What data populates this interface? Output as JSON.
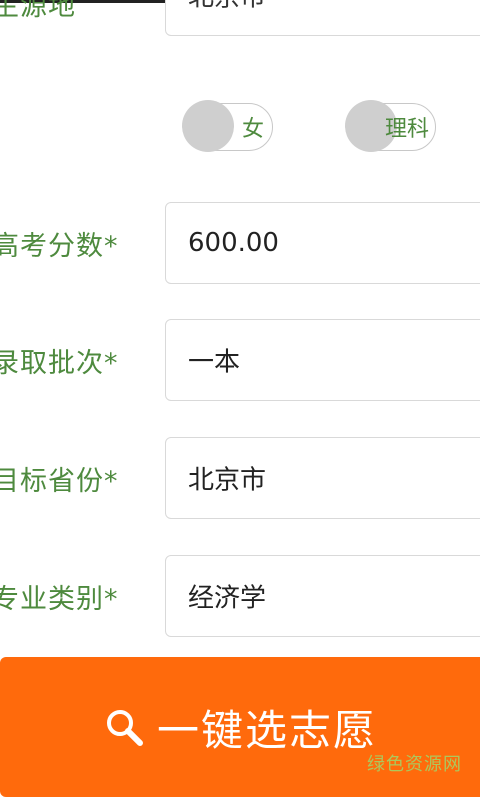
{
  "form": {
    "partial_row": {
      "label": "生源地",
      "value": "北京市"
    },
    "gender_toggle": {
      "label": "女"
    },
    "subject_toggle": {
      "label": "理科"
    },
    "score": {
      "label": "高考分数*",
      "value": "600.00"
    },
    "batch": {
      "label": "录取批次*",
      "value": "一本"
    },
    "target_province": {
      "label": "目标省份*",
      "value": "北京市"
    },
    "major_category": {
      "label": "专业类别*",
      "value": "经济学"
    }
  },
  "action": {
    "search_label": "一键选志愿"
  },
  "watermark": {
    "text": "绿色资源网"
  },
  "colors": {
    "accent": "#ff6a0c",
    "label_green": "#4e8a3e"
  },
  "icons": {
    "search": "search-icon"
  }
}
